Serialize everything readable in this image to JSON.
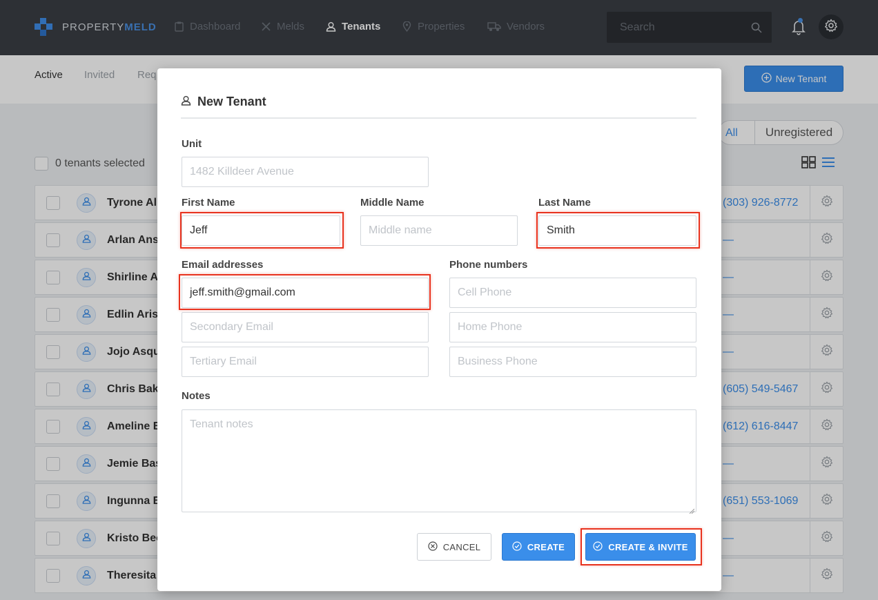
{
  "nav": {
    "brand_light": "PROPERTY",
    "brand_bold": "MELD",
    "items": [
      {
        "label": "Dashboard",
        "icon": "clipboard-icon"
      },
      {
        "label": "Melds",
        "icon": "tools-icon"
      },
      {
        "label": "Tenants",
        "icon": "user-icon",
        "active": true
      },
      {
        "label": "Properties",
        "icon": "map-pin-icon"
      },
      {
        "label": "Vendors",
        "icon": "truck-icon"
      }
    ],
    "search_placeholder": "Search"
  },
  "subnav": {
    "tabs": [
      "Active",
      "Invited",
      "Req"
    ],
    "new_tenant_label": "New Tenant"
  },
  "list": {
    "filter_all": "All",
    "filter_unregistered": "Unregistered",
    "selected_text": "0 tenants selected",
    "rows": [
      {
        "name": "Tyrone Al",
        "phone": "(303) 926-8772"
      },
      {
        "name": "Arlan Ans",
        "phone": "—"
      },
      {
        "name": "Shirline A",
        "phone": "—"
      },
      {
        "name": "Edlin Arist",
        "phone": "—"
      },
      {
        "name": "Jojo Asque",
        "phone": "—"
      },
      {
        "name": "Chris Bake",
        "phone": "(605) 549-5467"
      },
      {
        "name": "Ameline B",
        "phone": "(612) 616-8447"
      },
      {
        "name": "Jemie Bas",
        "phone": "—"
      },
      {
        "name": "Ingunna B",
        "phone": "(651) 553-1069"
      },
      {
        "name": "Kristo Bec",
        "phone": "—"
      },
      {
        "name": "Theresita",
        "phone": "—"
      }
    ]
  },
  "modal": {
    "title": "New Tenant",
    "unit_label": "Unit",
    "unit_placeholder": "1482 Killdeer Avenue",
    "first_name_label": "First Name",
    "first_name_value": "Jeff",
    "middle_name_label": "Middle Name",
    "middle_name_placeholder": "Middle name",
    "last_name_label": "Last Name",
    "last_name_value": "Smith",
    "email_label": "Email addresses",
    "email_value": "jeff.smith@gmail.com",
    "secondary_email_placeholder": "Secondary Email",
    "tertiary_email_placeholder": "Tertiary Email",
    "phone_label": "Phone numbers",
    "cell_placeholder": "Cell Phone",
    "home_placeholder": "Home Phone",
    "business_placeholder": "Business Phone",
    "notes_label": "Notes",
    "notes_placeholder": "Tenant notes",
    "cancel_label": "CANCEL",
    "create_label": "CREATE",
    "create_invite_label": "CREATE & INVITE"
  },
  "colors": {
    "accent": "#3a8eea",
    "nav_bg": "#3a3e45",
    "highlight": "#e8321e"
  }
}
